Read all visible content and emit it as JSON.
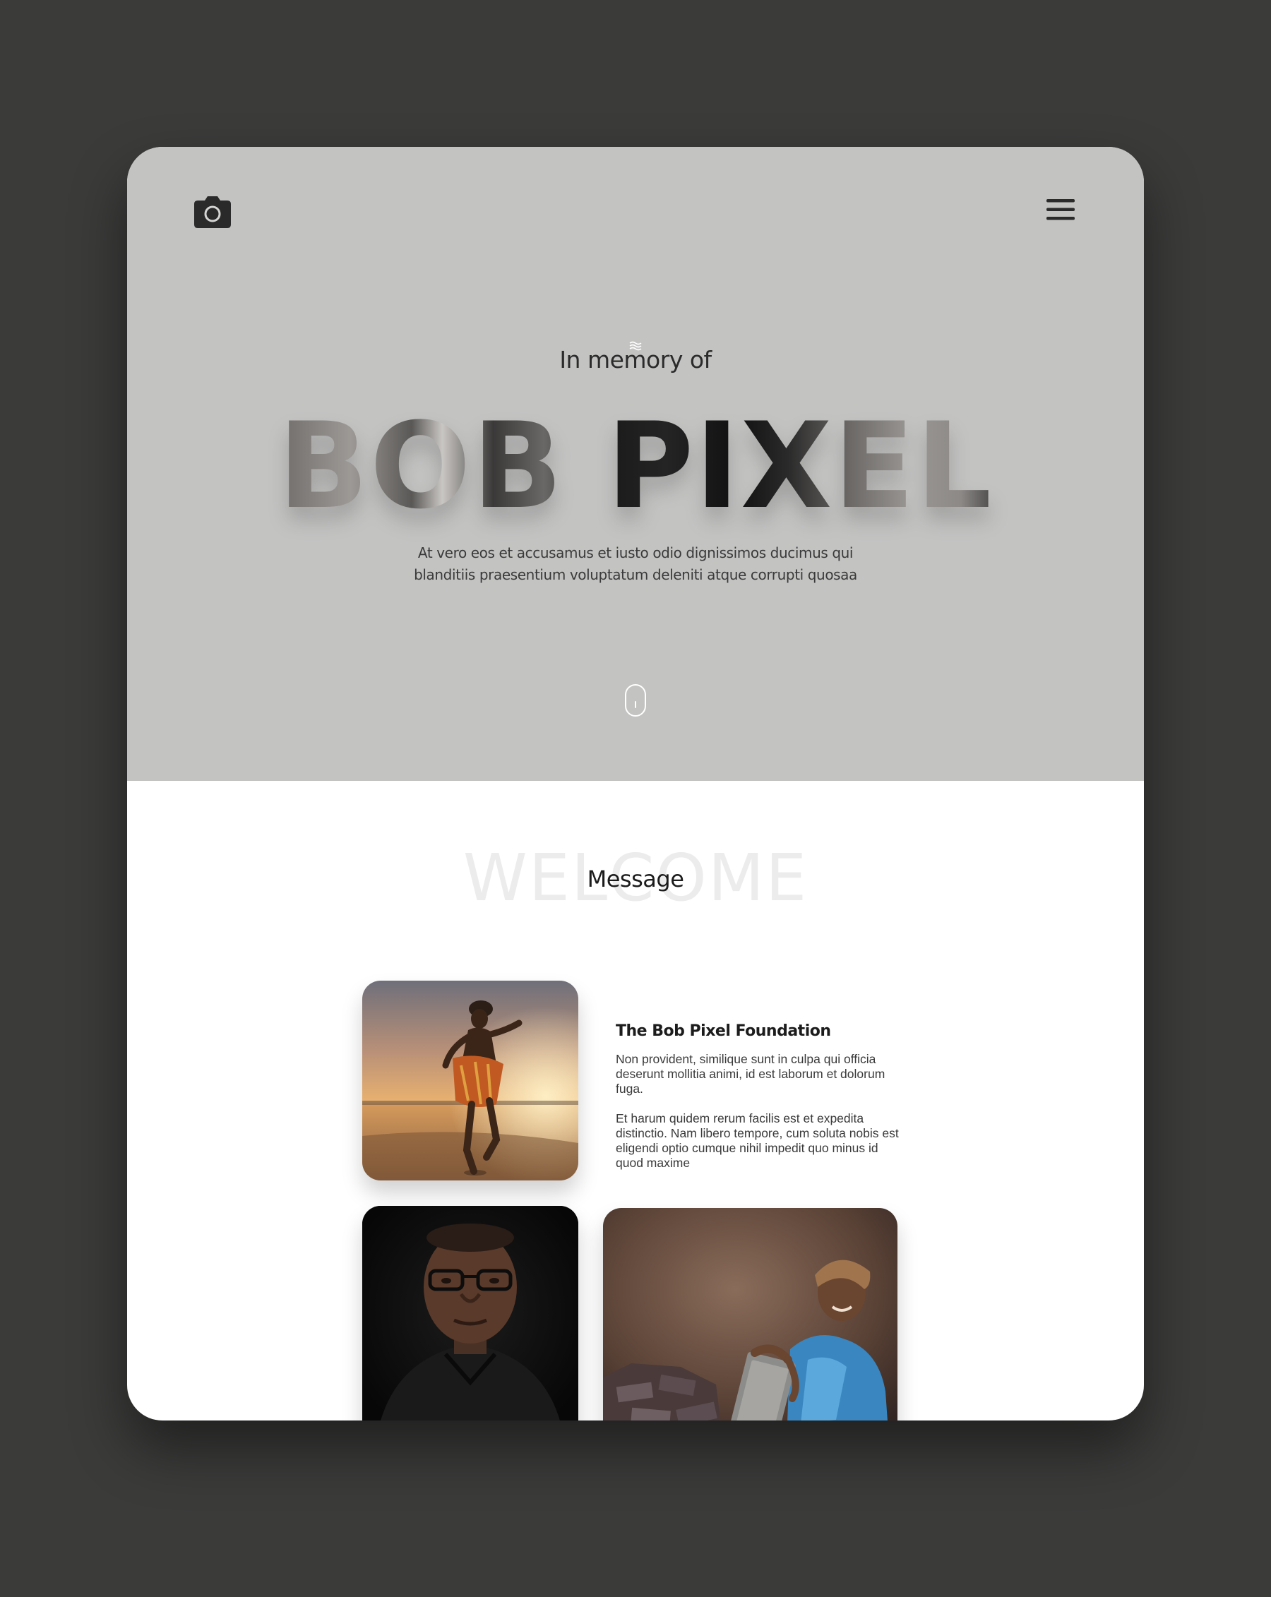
{
  "hero": {
    "pretitle": "In memory of",
    "name": "BOB PIXEL",
    "description": "At vero eos et accusamus et iusto odio dignissimos ducimus qui blanditiis praesentium voluptatum deleniti atque corrupti quosaa"
  },
  "icons": {
    "logo": "camera-icon",
    "menu": "hamburger-menu-icon",
    "decoration": "waves-icon",
    "scroll": "scroll-mouse-icon"
  },
  "section": {
    "background_word": "WELCOME",
    "title": "Message"
  },
  "foundation": {
    "title": "The Bob Pixel Foundation",
    "paragraph_1": "Non provident, similique sunt in culpa qui officia deserunt mollitia animi, id est laborum et dolorum fuga.",
    "paragraph_2": "Et harum quidem rerum facilis est et expedita distinctio. Nam libero tempore, cum soluta nobis est eligendi optio cumque nihil impedit quo minus id quod maxime"
  },
  "colors": {
    "page_background": "#3b3b3a",
    "hero_background": "#c3c3c2",
    "content_background": "#ffffff",
    "text_dark": "#1c1c1c"
  }
}
